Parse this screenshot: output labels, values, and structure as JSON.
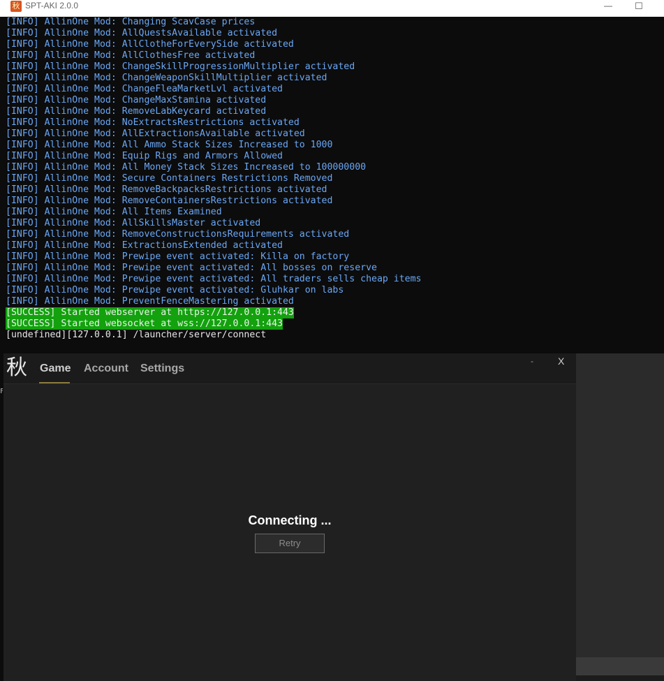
{
  "console": {
    "title": "SPT-AKI 2.0.0",
    "icon": "maple-leaf-icon",
    "controls": {
      "minimize": "—",
      "maximize": "☐"
    },
    "colors": {
      "info": "#6aa7f5",
      "success_bg": "#13a10e",
      "plain": "#e6e6e6"
    },
    "lines": [
      {
        "type": "info",
        "text": "[INFO] AllinOne Mod: Changing ScavCase prices"
      },
      {
        "type": "info",
        "text": "[INFO] AllinOne Mod: AllQuestsAvailable activated"
      },
      {
        "type": "info",
        "text": "[INFO] AllinOne Mod: AllClotheForEverySide activated"
      },
      {
        "type": "info",
        "text": "[INFO] AllinOne Mod: AllClothesFree activated"
      },
      {
        "type": "info",
        "text": "[INFO] AllinOne Mod: ChangeSkillProgressionMultiplier activated"
      },
      {
        "type": "info",
        "text": "[INFO] AllinOne Mod: ChangeWeaponSkillMultiplier activated"
      },
      {
        "type": "info",
        "text": "[INFO] AllinOne Mod: ChangeFleaMarketLvl activated"
      },
      {
        "type": "info",
        "text": "[INFO] AllinOne Mod: ChangeMaxStamina activated"
      },
      {
        "type": "info",
        "text": "[INFO] AllinOne Mod: RemoveLabKeycard activated"
      },
      {
        "type": "info",
        "text": "[INFO] AllinOne Mod: NoExtractsRestrictions activated"
      },
      {
        "type": "info",
        "text": "[INFO] AllinOne Mod: AllExtractionsAvailable activated"
      },
      {
        "type": "info",
        "text": "[INFO] AllinOne Mod: All Ammo Stack Sizes Increased to 1000"
      },
      {
        "type": "info",
        "text": "[INFO] AllinOne Mod: Equip Rigs and Armors Allowed"
      },
      {
        "type": "info",
        "text": "[INFO] AllinOne Mod: All Money Stack Sizes Increased to 100000000"
      },
      {
        "type": "info",
        "text": "[INFO] AllinOne Mod: Secure Containers Restrictions Removed"
      },
      {
        "type": "info",
        "text": "[INFO] AllinOne Mod: RemoveBackpacksRestrictions activated"
      },
      {
        "type": "info",
        "text": "[INFO] AllinOne Mod: RemoveContainersRestrictions activated"
      },
      {
        "type": "info",
        "text": "[INFO] AllinOne Mod: All Items Examined"
      },
      {
        "type": "info",
        "text": "[INFO] AllinOne Mod: AllSkillsMaster activated"
      },
      {
        "type": "info",
        "text": "[INFO] AllinOne Mod: RemoveConstructionsRequirements activated"
      },
      {
        "type": "info",
        "text": "[INFO] AllinOne Mod: ExtractionsExtended activated"
      },
      {
        "type": "info",
        "text": "[INFO] AllinOne Mod: Prewipe event activated: Killa on factory"
      },
      {
        "type": "info",
        "text": "[INFO] AllinOne Mod: Prewipe event activated: All bosses on reserve"
      },
      {
        "type": "info",
        "text": "[INFO] AllinOne Mod: Prewipe event activated: All traders sells cheap items"
      },
      {
        "type": "info",
        "text": "[INFO] AllinOne Mod: Prewipe event activated: Gluhkar on labs"
      },
      {
        "type": "info",
        "text": "[INFO] AllinOne Mod: PreventFenceMastering activated"
      },
      {
        "type": "success",
        "text": "[SUCCESS] Started webserver at https://127.0.0.1:443"
      },
      {
        "type": "success",
        "text": "[SUCCESS] Started websocket at wss://127.0.0.1:443"
      },
      {
        "type": "plain",
        "text": "[undefined][127.0.0.1] /launcher/server/connect"
      }
    ]
  },
  "launcher": {
    "logo": "秋",
    "tabs": [
      {
        "label": "Game",
        "active": true
      },
      {
        "label": "Account",
        "active": false
      },
      {
        "label": "Settings",
        "active": false
      }
    ],
    "controls": {
      "minimize": "-",
      "close": "X"
    },
    "status": "Connecting ...",
    "retry_label": "Retry",
    "accent": "#8a7a3e"
  },
  "misc": {
    "edge_glyph": "F"
  }
}
